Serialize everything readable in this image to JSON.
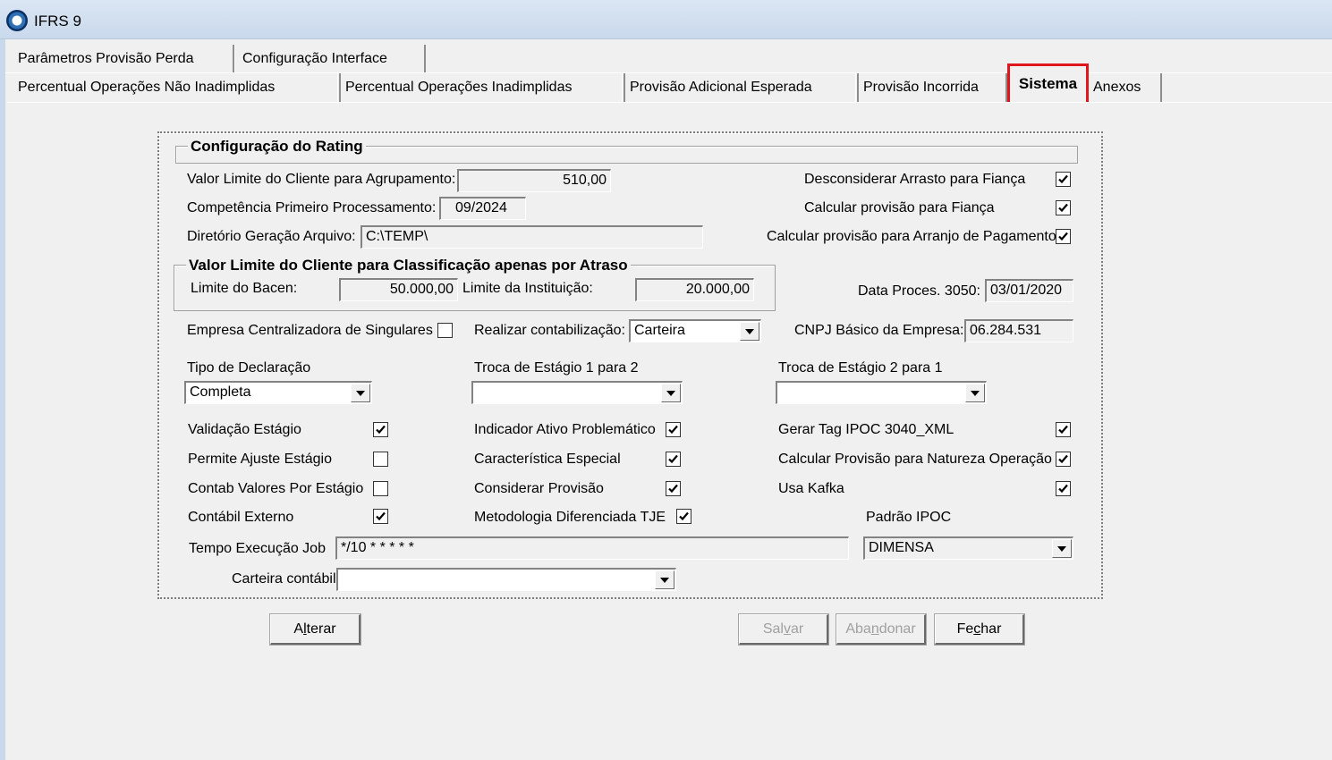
{
  "window": {
    "title": "IFRS 9"
  },
  "tabs_row1": [
    "Parâmetros Provisão Perda",
    "Configuração Interface"
  ],
  "tabs_row2": [
    "Percentual Operações Não Inadimplidas",
    "Percentual Operações Inadimplidas",
    "Provisão Adicional Esperada",
    "Provisão Incorrida",
    "Sistema",
    "Anexos"
  ],
  "active_tab": "Sistema",
  "rating": {
    "title": "Configuração do Rating",
    "valor_limite_label": "Valor Limite do Cliente para Agrupamento:",
    "valor_limite_value": "510,00",
    "competencia_label": "Competência Primeiro Processamento:",
    "competencia_value": "09/2024",
    "diretorio_label": "Diretório Geração Arquivo:",
    "diretorio_value": "C:\\TEMP\\",
    "desconsiderar_label": "Desconsiderar Arrasto para Fiança",
    "desconsiderar_checked": true,
    "calc_fianca_label": "Calcular provisão para Fiança",
    "calc_fianca_checked": true,
    "calc_arranjo_label": "Calcular provisão para Arranjo de Pagamento",
    "calc_arranjo_checked": true
  },
  "atraso": {
    "title": "Valor Limite do Cliente para Classificação apenas por Atraso",
    "bacen_label": "Limite do Bacen:",
    "bacen_value": "50.000,00",
    "instituicao_label": "Limite da Instituição:",
    "instituicao_value": "20.000,00"
  },
  "data_proces_label": "Data Proces. 3050:",
  "data_proces_value": "03/01/2020",
  "empresa_central_label": "Empresa Centralizadora de Singulares",
  "empresa_central_checked": false,
  "realizar_label": "Realizar contabilização:",
  "realizar_value": "Carteira",
  "cnpj_label": "CNPJ Básico da Empresa:",
  "cnpj_value": "06.284.531",
  "tipo_decl_label": "Tipo de Declaração",
  "tipo_decl_value": "Completa",
  "troca12_label": "Troca de Estágio 1 para 2",
  "troca12_value": "",
  "troca21_label": "Troca de Estágio 2 para 1",
  "troca21_value": "",
  "checks": {
    "validacao": {
      "label": "Validação Estágio",
      "checked": true
    },
    "permite": {
      "label": "Permite Ajuste Estágio",
      "checked": false
    },
    "contab_valores": {
      "label": "Contab Valores Por Estágio",
      "checked": false
    },
    "contabil_externo": {
      "label": "Contábil Externo",
      "checked": true
    },
    "indicador": {
      "label": "Indicador Ativo Problemático",
      "checked": true
    },
    "caracteristica": {
      "label": "Característica Especial",
      "checked": true
    },
    "considerar": {
      "label": "Considerar Provisão",
      "checked": true
    },
    "metodologia": {
      "label": "Metodologia Diferenciada TJE",
      "checked": true
    },
    "gerar_tag": {
      "label": "Gerar Tag IPOC 3040_XML",
      "checked": true
    },
    "calc_natureza": {
      "label": "Calcular Provisão para Natureza Operação",
      "checked": true
    },
    "usa_kafka": {
      "label": "Usa Kafka",
      "checked": true
    }
  },
  "padrao_ipoc_label": "Padrão IPOC",
  "padrao_ipoc_value": "DIMENSA",
  "tempo_label": "Tempo Execução Job",
  "tempo_value": "*/10 * * * * *",
  "carteira_label": "Carteira contábil",
  "carteira_value": "",
  "buttons": {
    "alterar": {
      "pre": "A",
      "mn": "l",
      "post": "terar"
    },
    "salvar": {
      "pre": "Sal",
      "mn": "v",
      "post": "ar"
    },
    "abandonar": {
      "pre": "Aba",
      "mn": "n",
      "post": "donar"
    },
    "fechar": {
      "pre": "Fe",
      "mn": "c",
      "post": "har"
    }
  }
}
